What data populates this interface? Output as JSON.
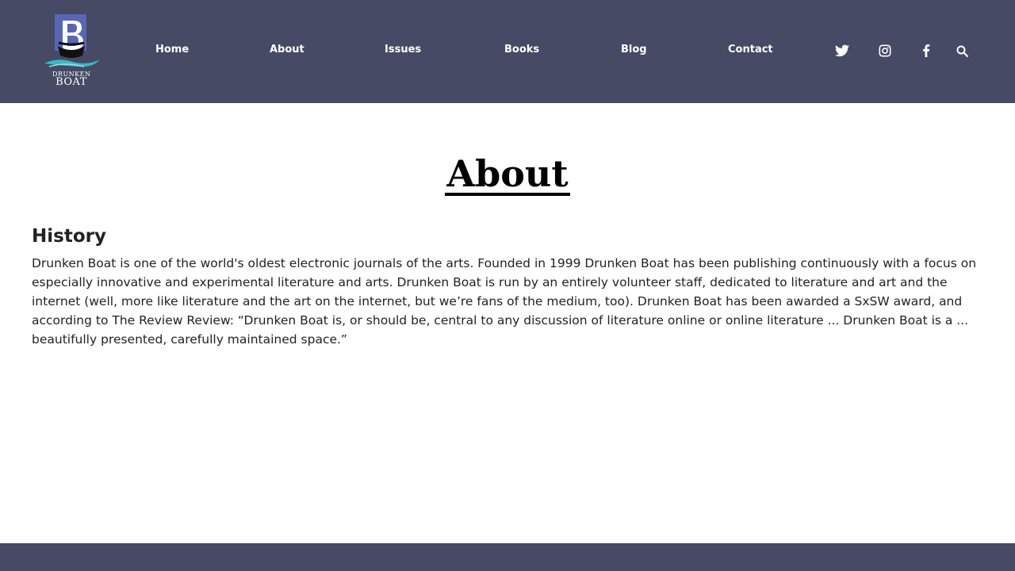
{
  "colors": {
    "header_bg": "#464a64",
    "logo_blue": "#5866b4",
    "logo_water": "#3bb7c4",
    "nav_text": "#ffffff"
  },
  "logo": {
    "word1": "DRUNKEN",
    "word2": "BOAT"
  },
  "nav": {
    "items": [
      {
        "label": "Home"
      },
      {
        "label": "About"
      },
      {
        "label": "Issues"
      },
      {
        "label": "Books"
      },
      {
        "label": "Blog"
      },
      {
        "label": "Contact"
      }
    ]
  },
  "social": {
    "icons": [
      "twitter-icon",
      "instagram-icon",
      "facebook-icon",
      "search-icon"
    ]
  },
  "main": {
    "title": "About",
    "section_heading": "History",
    "history_text": "Drunken Boat is one of the world's oldest electronic journals of the arts. Founded in 1999 Drunken Boat has been publishing continuously with a focus on especially innovative and experimental literature and arts. Drunken Boat is run by an entirely volunteer staff, dedicated to literature and art and the internet (well, more like literature and the art on the internet, but we’re fans of the medium, too). Drunken Boat has been awarded a SxSW award, and according to The Review Review: “Drunken Boat is, or should be, central to any discussion of literature online or online literature ... Drunken Boat is a ... beautifully presented, carefully maintained space.”"
  }
}
